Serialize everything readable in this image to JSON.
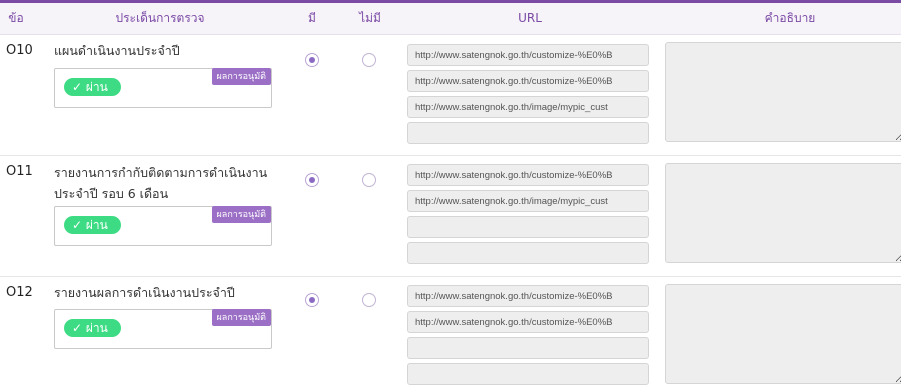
{
  "header": {
    "col_no": "ข้อ",
    "col_topic": "ประเด็นการตรวจ",
    "col_yes": "มี",
    "col_no_have": "ไม่มี",
    "col_url": "URL",
    "col_desc": "คำอธิบาย"
  },
  "items": [
    {
      "id": "O10",
      "title": "แผนดำเนินงานประจำปี",
      "status_tag": "ผลการอนุมัติ",
      "status": "✓ ผ่าน",
      "selected": "yes",
      "urls": [
        "http://www.satengnok.go.th/customize-%E0%B",
        "http://www.satengnok.go.th/customize-%E0%B",
        "http://www.satengnok.go.th/image/mypic_cust",
        ""
      ],
      "description": ""
    },
    {
      "id": "O11",
      "title": "รายงานการกำกับติดตามการดำเนินงานประจำปี รอบ 6 เดือน",
      "status_tag": "ผลการอนุมัติ",
      "status": "✓ ผ่าน",
      "selected": "yes",
      "urls": [
        "http://www.satengnok.go.th/customize-%E0%B",
        "http://www.satengnok.go.th/image/mypic_cust",
        "",
        ""
      ],
      "description": ""
    },
    {
      "id": "O12",
      "title": "รายงานผลการดำเนินงานประจำปี",
      "status_tag": "ผลการอนุมัติ",
      "status": "✓ ผ่าน",
      "selected": "yes",
      "urls": [
        "http://www.satengnok.go.th/customize-%E0%B",
        "http://www.satengnok.go.th/customize-%E0%B",
        "",
        ""
      ],
      "description": ""
    }
  ],
  "colors": {
    "accent": "#7b4aa5",
    "pass": "#3ddc84",
    "tag": "#9b6fc6"
  }
}
